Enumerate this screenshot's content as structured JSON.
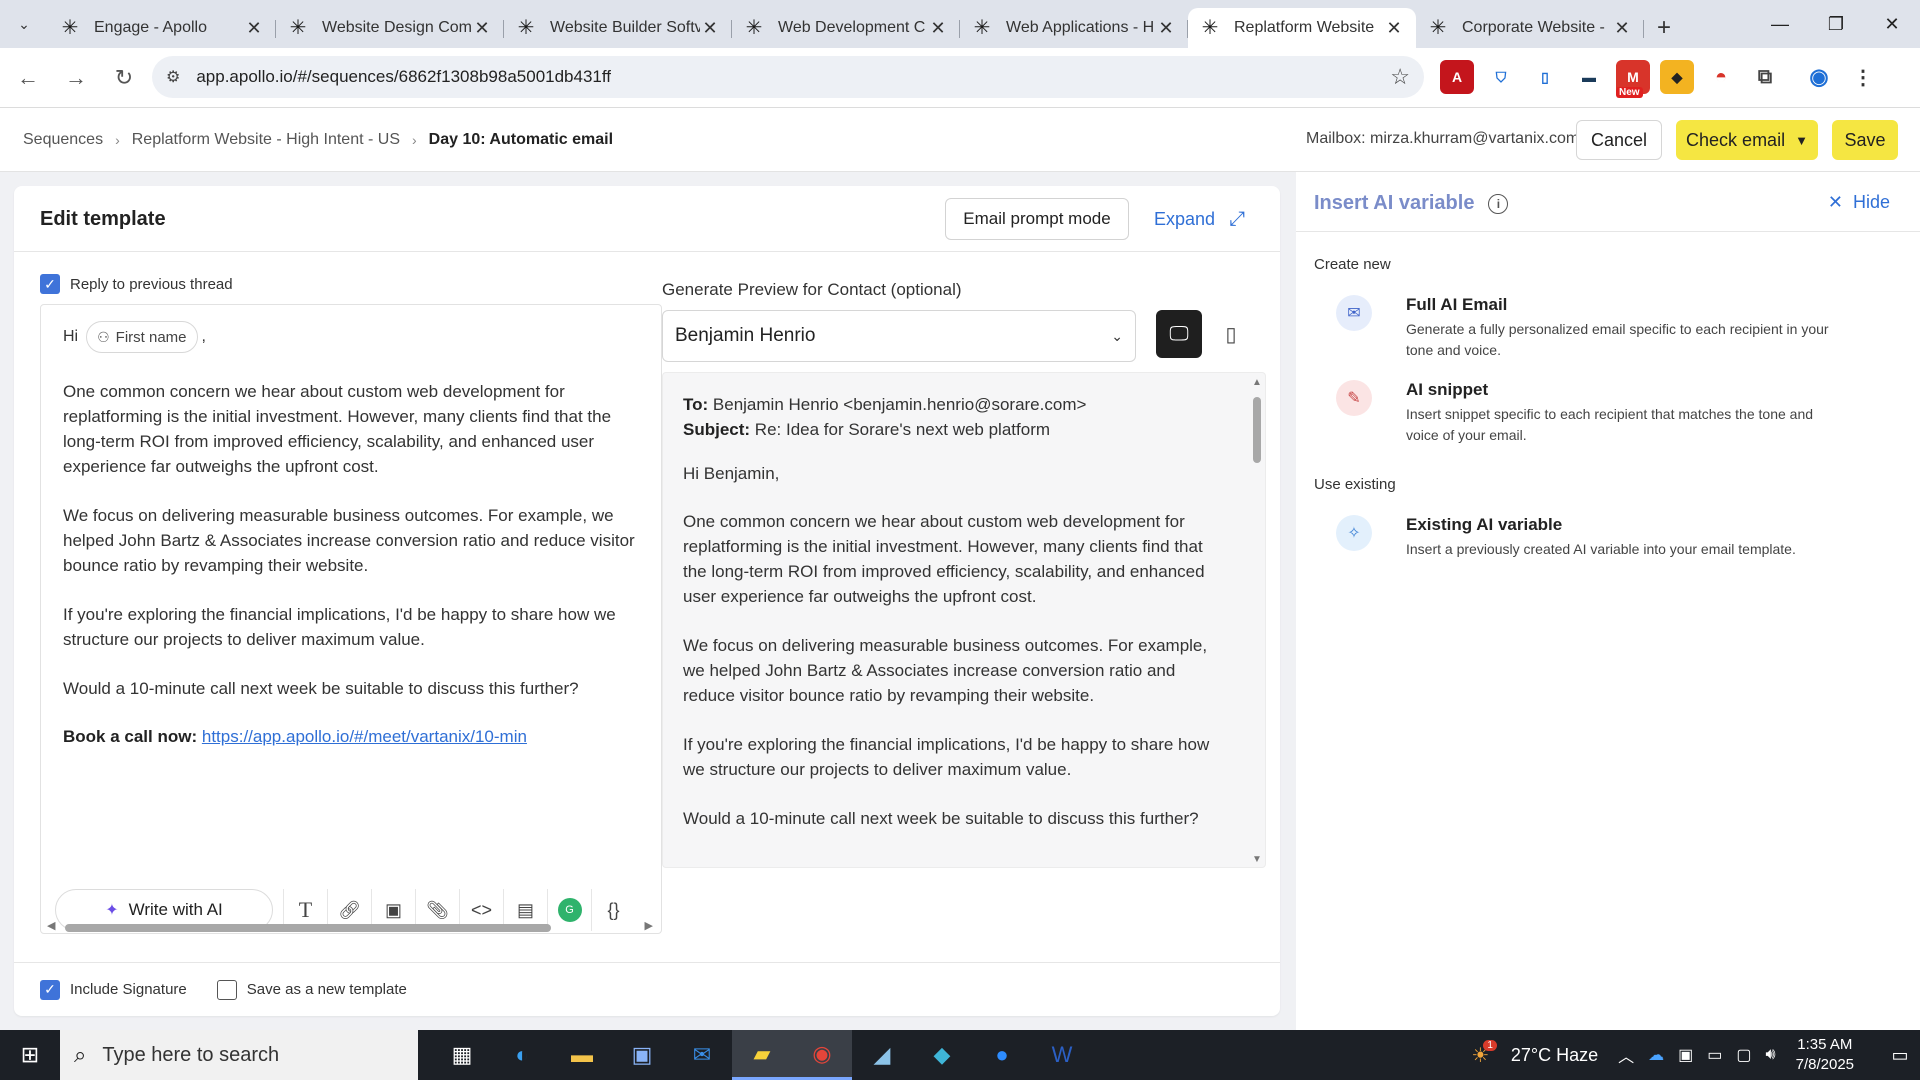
{
  "browser": {
    "tabs": [
      {
        "title": "Engage - Apollo",
        "active": false
      },
      {
        "title": "Website Design Com",
        "active": false
      },
      {
        "title": "Website Builder Softv",
        "active": false
      },
      {
        "title": "Web Development C",
        "active": false
      },
      {
        "title": "Web Applications - H",
        "active": false
      },
      {
        "title": "Replatform Website",
        "active": true
      },
      {
        "title": "Corporate Website -",
        "active": false
      }
    ],
    "url": "app.apollo.io/#/sequences/6862f1308b98a5001db431ff",
    "new_badge": "New"
  },
  "header": {
    "breadcrumb": [
      "Sequences",
      "Replatform Website - High Intent - US",
      "Day 10: Automatic email"
    ],
    "mailbox": "Mailbox: mirza.khurram@vartanix.com",
    "cancel": "Cancel",
    "check_email": "Check email",
    "save": "Save"
  },
  "editor": {
    "title": "Edit template",
    "prompt_mode": "Email prompt mode",
    "expand": "Expand",
    "reply_label": "Reply to previous thread",
    "reply_checked": true,
    "greeting": "Hi",
    "first_name_chip": "First name",
    "greeting_end": ",",
    "paragraphs": [
      "One common concern we hear about custom web development for replatforming is the initial investment. However, many clients find that the long-term ROI from improved efficiency, scalability, and enhanced user experience far outweighs the upfront cost.",
      "We focus on delivering measurable business outcomes. For example, we helped John Bartz & Associates increase conversion ratio and reduce visitor bounce ratio by revamping their website.",
      "If you're exploring the financial implications, I'd be happy to share how we structure our projects to deliver maximum value.",
      "Would a 10-minute call next week be suitable to discuss this further?"
    ],
    "book_label": "Book a call now:",
    "book_link": "https://app.apollo.io/#/meet/vartanix/10-min",
    "write_ai": "Write with AI",
    "include_signature": "Include Signature",
    "include_signature_checked": true,
    "save_new_template": "Save as a new template",
    "save_new_template_checked": false
  },
  "preview": {
    "label": "Generate Preview for Contact (optional)",
    "contact": "Benjamin Henrio",
    "to_label": "To:",
    "to_value": "Benjamin Henrio <benjamin.henrio@sorare.com>",
    "subject_label": "Subject:",
    "subject_value": "Re: Idea for Sorare's next web platform",
    "greeting": "Hi Benjamin,",
    "paragraphs": [
      "One common concern we hear about custom web development for replatforming is the initial investment. However, many clients find that the long-term ROI from improved efficiency, scalability, and enhanced user experience far outweighs the upfront cost.",
      "We focus on delivering measurable business outcomes. For example, we helped John Bartz & Associates increase conversion ratio and reduce visitor bounce ratio by revamping their website.",
      "If you're exploring the financial implications, I'd be happy to share how we structure our projects to deliver maximum value.",
      "Would a 10-minute call next week be suitable to discuss this further?"
    ]
  },
  "ai_panel": {
    "title": "Insert AI variable",
    "hide": "Hide",
    "create_new": "Create new",
    "use_existing": "Use existing",
    "options": [
      {
        "name": "Full AI Email",
        "desc": "Generate a fully personalized email specific to each recipient in your tone and voice."
      },
      {
        "name": "AI snippet",
        "desc": "Insert snippet specific to each recipient that matches the tone and voice of your email."
      },
      {
        "name": "Existing AI variable",
        "desc": "Insert a previously created AI variable into your email template."
      }
    ]
  },
  "taskbar": {
    "search_placeholder": "Type here to search",
    "weather": "27°C Haze",
    "weather_badge": "1",
    "time": "1:35 AM",
    "date": "7/8/2025"
  },
  "colors": {
    "accent_yellow": "#f5e642",
    "link_blue": "#2f6fd6",
    "checkbox_blue": "#3f73d9",
    "ai_title": "#7a8cc9"
  }
}
